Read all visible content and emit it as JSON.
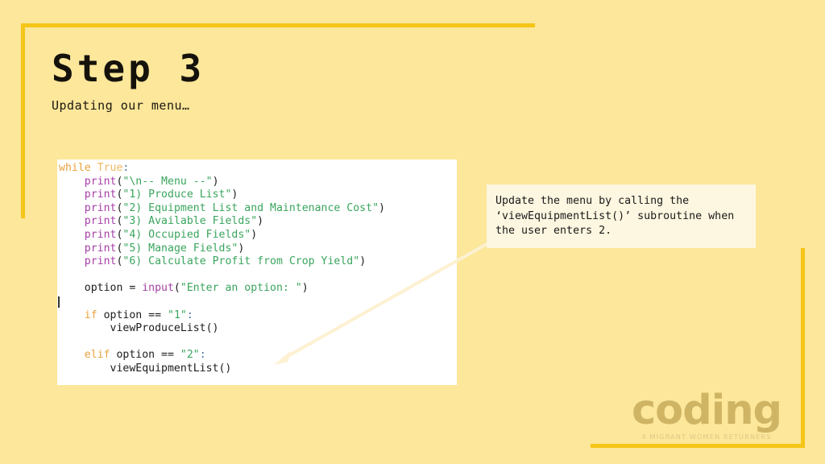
{
  "slide": {
    "background_color": "#fce79a",
    "accent_color": "#f5c518",
    "title": "Step 3",
    "subtitle": "Updating our menu…"
  },
  "code_panel": {
    "background_color": "#ffffff",
    "language": "python",
    "lines": [
      [
        {
          "t": "while ",
          "c": "tok-kw"
        },
        {
          "t": "True",
          "c": "tok-const"
        },
        {
          "t": ":",
          "c": "tok-punct"
        }
      ],
      [
        {
          "t": "    ",
          "c": "tok-plain"
        },
        {
          "t": "print",
          "c": "tok-builtin"
        },
        {
          "t": "(",
          "c": "tok-op"
        },
        {
          "t": "\"\\n-- Menu --\"",
          "c": "tok-str"
        },
        {
          "t": ")",
          "c": "tok-op"
        }
      ],
      [
        {
          "t": "    ",
          "c": "tok-plain"
        },
        {
          "t": "print",
          "c": "tok-builtin"
        },
        {
          "t": "(",
          "c": "tok-op"
        },
        {
          "t": "\"1) Produce List\"",
          "c": "tok-str"
        },
        {
          "t": ")",
          "c": "tok-op"
        }
      ],
      [
        {
          "t": "    ",
          "c": "tok-plain"
        },
        {
          "t": "print",
          "c": "tok-builtin"
        },
        {
          "t": "(",
          "c": "tok-op"
        },
        {
          "t": "\"2) Equipment List and Maintenance Cost\"",
          "c": "tok-str"
        },
        {
          "t": ")",
          "c": "tok-op"
        }
      ],
      [
        {
          "t": "    ",
          "c": "tok-plain"
        },
        {
          "t": "print",
          "c": "tok-builtin"
        },
        {
          "t": "(",
          "c": "tok-op"
        },
        {
          "t": "\"3) Available Fields\"",
          "c": "tok-str"
        },
        {
          "t": ")",
          "c": "tok-op"
        }
      ],
      [
        {
          "t": "    ",
          "c": "tok-plain"
        },
        {
          "t": "print",
          "c": "tok-builtin"
        },
        {
          "t": "(",
          "c": "tok-op"
        },
        {
          "t": "\"4) Occupied Fields\"",
          "c": "tok-str"
        },
        {
          "t": ")",
          "c": "tok-op"
        }
      ],
      [
        {
          "t": "    ",
          "c": "tok-plain"
        },
        {
          "t": "print",
          "c": "tok-builtin"
        },
        {
          "t": "(",
          "c": "tok-op"
        },
        {
          "t": "\"5) Manage Fields\"",
          "c": "tok-str"
        },
        {
          "t": ")",
          "c": "tok-op"
        }
      ],
      [
        {
          "t": "    ",
          "c": "tok-plain"
        },
        {
          "t": "print",
          "c": "tok-builtin"
        },
        {
          "t": "(",
          "c": "tok-op"
        },
        {
          "t": "\"6) Calculate Profit from Crop Yield\"",
          "c": "tok-str"
        },
        {
          "t": ")",
          "c": "tok-op"
        }
      ],
      [],
      [
        {
          "t": "    option = ",
          "c": "tok-plain"
        },
        {
          "t": "input",
          "c": "tok-builtin"
        },
        {
          "t": "(",
          "c": "tok-op"
        },
        {
          "t": "\"Enter an option: \"",
          "c": "tok-str"
        },
        {
          "t": ")",
          "c": "tok-op"
        }
      ],
      [],
      [
        {
          "t": "    ",
          "c": "tok-plain"
        },
        {
          "t": "if",
          "c": "tok-kw"
        },
        {
          "t": " option == ",
          "c": "tok-plain"
        },
        {
          "t": "\"1\"",
          "c": "tok-str"
        },
        {
          "t": ":",
          "c": "tok-punct"
        }
      ],
      [
        {
          "t": "        viewProduceList()",
          "c": "tok-plain"
        }
      ],
      [],
      [
        {
          "t": "    ",
          "c": "tok-plain"
        },
        {
          "t": "elif",
          "c": "tok-kw"
        },
        {
          "t": " option == ",
          "c": "tok-plain"
        },
        {
          "t": "\"2\"",
          "c": "tok-str"
        },
        {
          "t": ":",
          "c": "tok-punct"
        }
      ],
      [
        {
          "t": "        viewEquipmentList()",
          "c": "tok-plain"
        }
      ]
    ]
  },
  "callout": {
    "background_color": "#fdf6e0",
    "text": "Update the menu by calling the ‘viewEquipmentList()’ subroutine when the user enters 2."
  },
  "logo": {
    "word": "coding",
    "tagline": "4 MIGRANT WOMEN RETURNERS",
    "color": "#cfb464"
  }
}
